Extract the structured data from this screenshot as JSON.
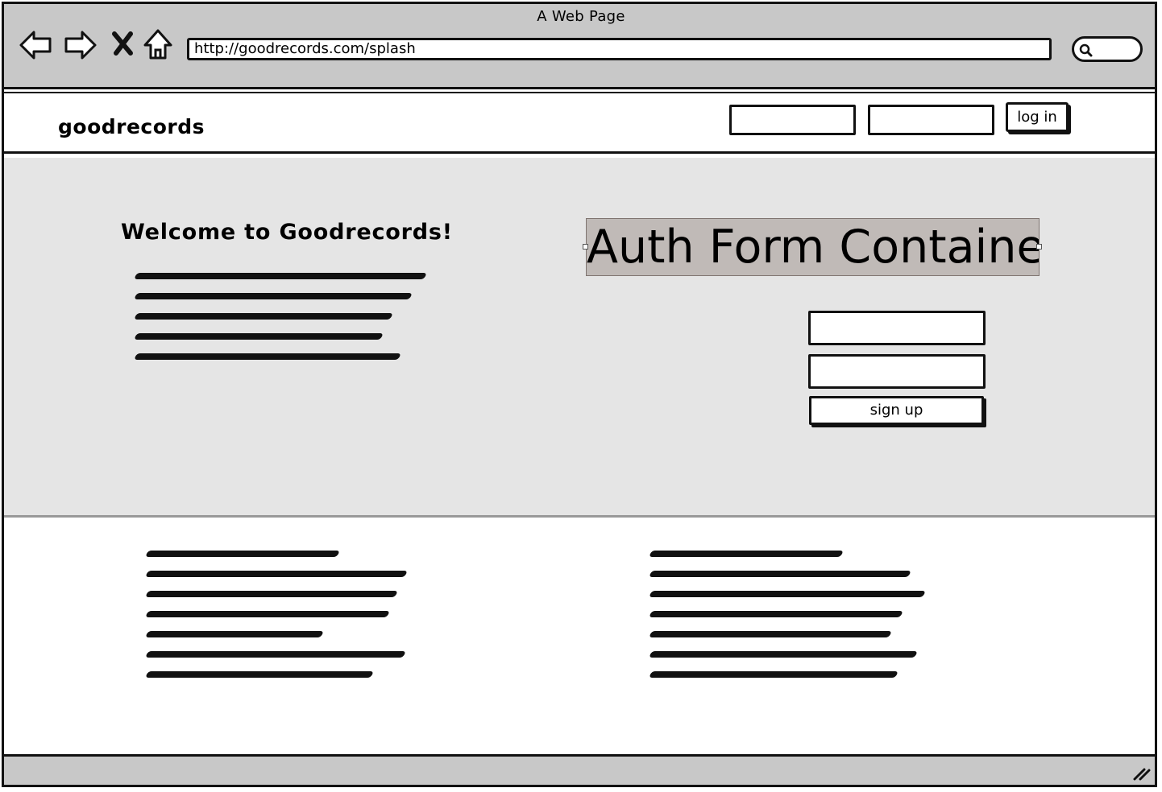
{
  "window": {
    "title": "A Web Page",
    "url": "http://goodrecords.com/splash",
    "icons": [
      "back-arrow-icon",
      "forward-arrow-icon",
      "stop-icon",
      "home-icon",
      "search-icon",
      "resize-grip-icon"
    ]
  },
  "header": {
    "logo": "goodrecords",
    "username_value": "",
    "password_value": "",
    "login_label": "log in"
  },
  "hero": {
    "title": "Welcome to Goodrecords!",
    "auth_container_label": "Auth Form Container",
    "signup_username_value": "",
    "signup_password_value": "",
    "signup_label": "sign up"
  },
  "colors": {
    "chrome": "#c8c8c8",
    "hero_background": "#e5e5e5",
    "auth_label_background": "#c0bab7"
  }
}
